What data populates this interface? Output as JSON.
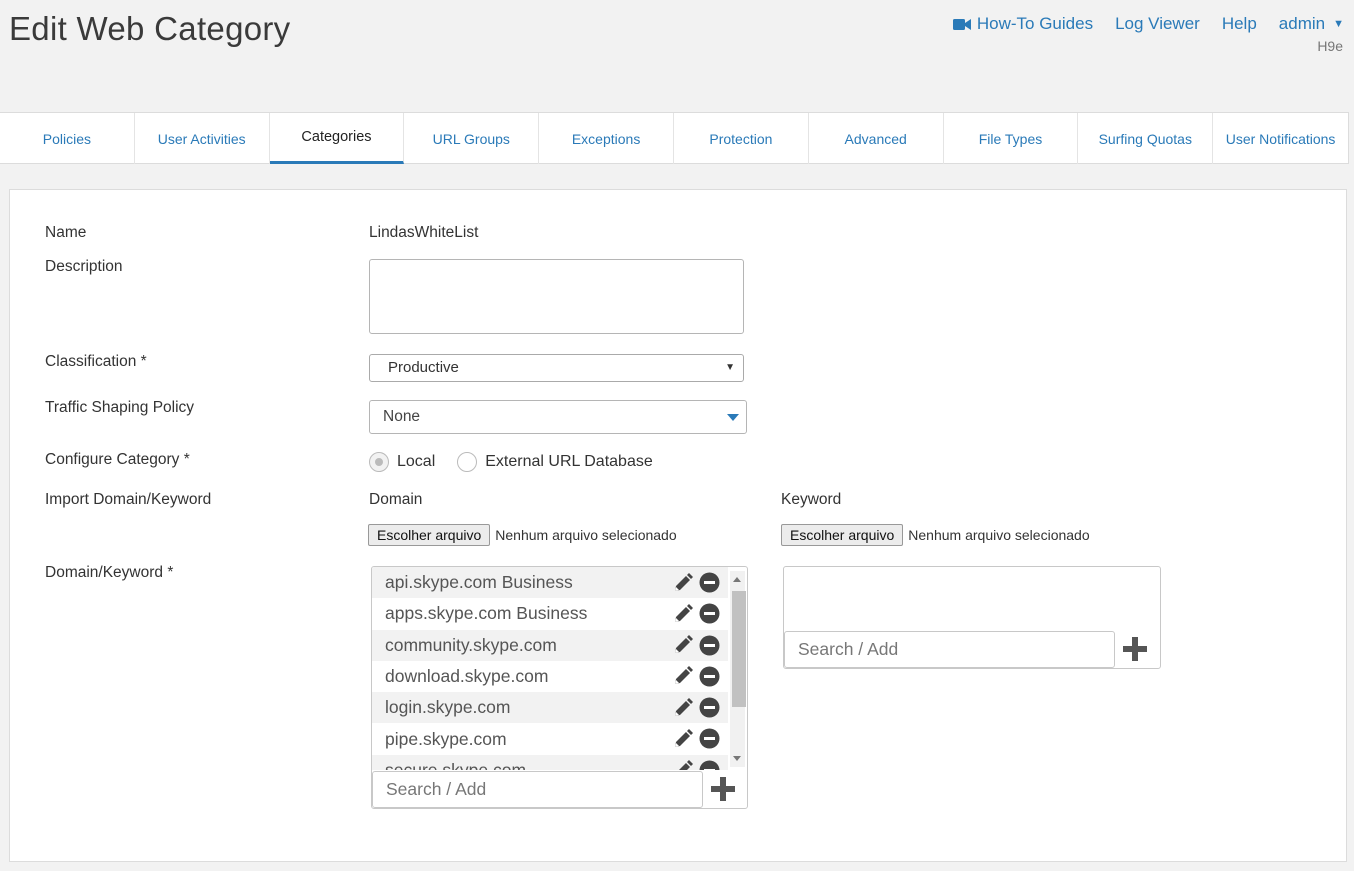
{
  "header": {
    "title": "Edit Web Category",
    "nav": {
      "howto": "How-To Guides",
      "logviewer": "Log Viewer",
      "help": "Help",
      "admin": "admin"
    },
    "hostname": "H9e"
  },
  "tabs": [
    {
      "label": "Policies"
    },
    {
      "label": "User Activities"
    },
    {
      "label": "Categories",
      "active": true
    },
    {
      "label": "URL Groups"
    },
    {
      "label": "Exceptions"
    },
    {
      "label": "Protection"
    },
    {
      "label": "Advanced"
    },
    {
      "label": "File Types"
    },
    {
      "label": "Surfing Quotas"
    },
    {
      "label": "User Notifications"
    }
  ],
  "form": {
    "name_label": "Name",
    "name_value": "LindasWhiteList",
    "description_label": "Description",
    "description_value": "",
    "classification_label": "Classification *",
    "classification_value": "Productive",
    "traffic_label": "Traffic Shaping Policy",
    "traffic_value": "None",
    "configure_label": "Configure Category *",
    "configure_options": {
      "local": "Local",
      "external": "External URL Database"
    },
    "configure_selected": "local",
    "import_label": "Import Domain/Keyword",
    "import_domain_label": "Domain",
    "import_keyword_label": "Keyword",
    "file_button": "Escolher arquivo",
    "file_none": "Nenhum arquivo selecionado",
    "domainkw_label": "Domain/Keyword *",
    "domains": [
      "api.skype.com Business",
      "apps.skype.com Business",
      "community.skype.com",
      "download.skype.com",
      "login.skype.com",
      "pipe.skype.com",
      "secure.skype.com"
    ],
    "search_placeholder": "Search / Add"
  },
  "colors": {
    "accent": "#2a7ab8",
    "icon_dark": "#444444"
  }
}
